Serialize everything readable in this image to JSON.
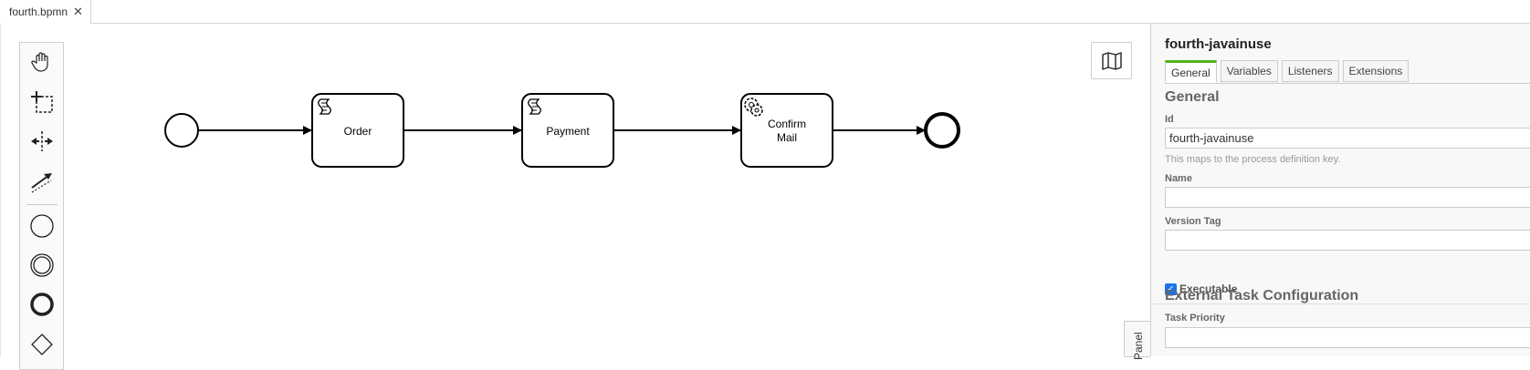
{
  "tabbar": {
    "file_tab": "fourth.bpmn",
    "close_glyph": "✕"
  },
  "palette": {
    "tools": [
      {
        "name": "hand-tool-icon"
      },
      {
        "name": "lasso-tool-icon"
      },
      {
        "name": "space-tool-icon"
      },
      {
        "name": "global-connect-tool-icon"
      },
      {
        "name": "create-start-event-icon"
      },
      {
        "name": "create-intermediate-event-icon"
      },
      {
        "name": "create-end-event-icon"
      },
      {
        "name": "create-gateway-icon"
      }
    ]
  },
  "diagram": {
    "tasks": [
      {
        "label_lines": [
          "Order"
        ],
        "type": "script-task"
      },
      {
        "label_lines": [
          "Payment"
        ],
        "type": "script-task"
      },
      {
        "label_lines": [
          "Confirm",
          "Mail"
        ],
        "type": "service-task"
      }
    ],
    "colors": {
      "stroke": "#000000",
      "fill": "#ffffff"
    }
  },
  "properties": {
    "title": "fourth-javainuse",
    "tabs": [
      "General",
      "Variables",
      "Listeners",
      "Extensions"
    ],
    "active_tab": "General",
    "general_group": "General",
    "id_label": "Id",
    "id_value": "fourth-javainuse",
    "id_hint": "This maps to the process definition key.",
    "name_label": "Name",
    "name_value": "",
    "version_label": "Version Tag",
    "version_value": "",
    "executable_label": "Executable",
    "executable_checked": true,
    "external_group": "External Task Configuration",
    "task_priority_label": "Task Priority",
    "panel_toggle": "Panel",
    "accent_color": "#52b415"
  }
}
